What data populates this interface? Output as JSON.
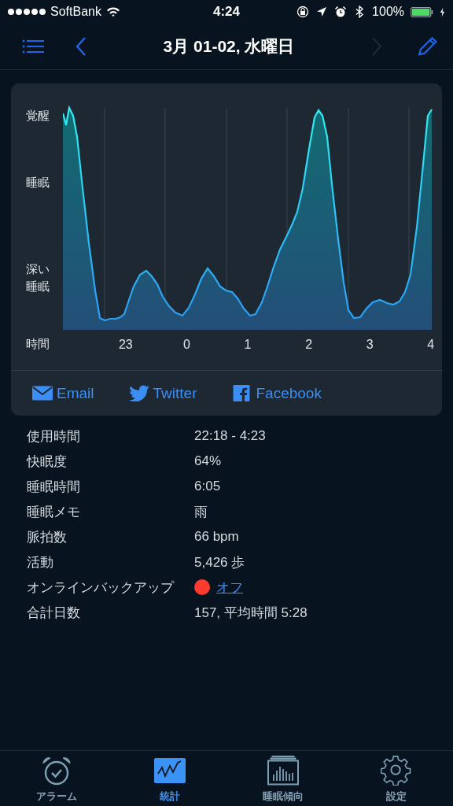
{
  "status_bar": {
    "carrier": "SoftBank",
    "time": "4:24",
    "battery": "100%"
  },
  "nav": {
    "title": "3月 01-02, 水曜日",
    "back": {
      "disabled": false
    },
    "forward": {
      "disabled": true
    }
  },
  "chart": {
    "y_labels": [
      "覚醒",
      "睡眠",
      "深い睡眠"
    ],
    "x_label": "時間",
    "x_ticks": [
      "23",
      "0",
      "1",
      "2",
      "3",
      "4"
    ]
  },
  "share": [
    {
      "kind": "email",
      "label": "Email"
    },
    {
      "kind": "twitter",
      "label": "Twitter"
    },
    {
      "kind": "facebook",
      "label": "Facebook"
    }
  ],
  "stats": [
    {
      "kind": "text",
      "label": "使用時間",
      "value": "22:18 - 4:23"
    },
    {
      "kind": "text",
      "label": "快眠度",
      "value": "64%"
    },
    {
      "kind": "text",
      "label": "睡眠時間",
      "value": "6:05"
    },
    {
      "kind": "text",
      "label": "睡眠メモ",
      "value": "雨"
    },
    {
      "kind": "text",
      "label": "脈拍数",
      "value": "66 bpm"
    },
    {
      "kind": "text",
      "label": "活動",
      "value": "5,426 歩"
    },
    {
      "kind": "link",
      "label": "オンラインバックアップ",
      "value": "オフ",
      "color": "#ff3b30"
    },
    {
      "kind": "text",
      "label": "合計日数",
      "value": "157, 平均時間 5:28"
    }
  ],
  "tabs": [
    {
      "kind": "alarm",
      "label": "アラーム",
      "selected": false
    },
    {
      "kind": "stats",
      "label": "統計",
      "selected": true
    },
    {
      "kind": "trend",
      "label": "睡眠傾向",
      "selected": false
    },
    {
      "kind": "settings",
      "label": "設定",
      "selected": false
    }
  ]
}
